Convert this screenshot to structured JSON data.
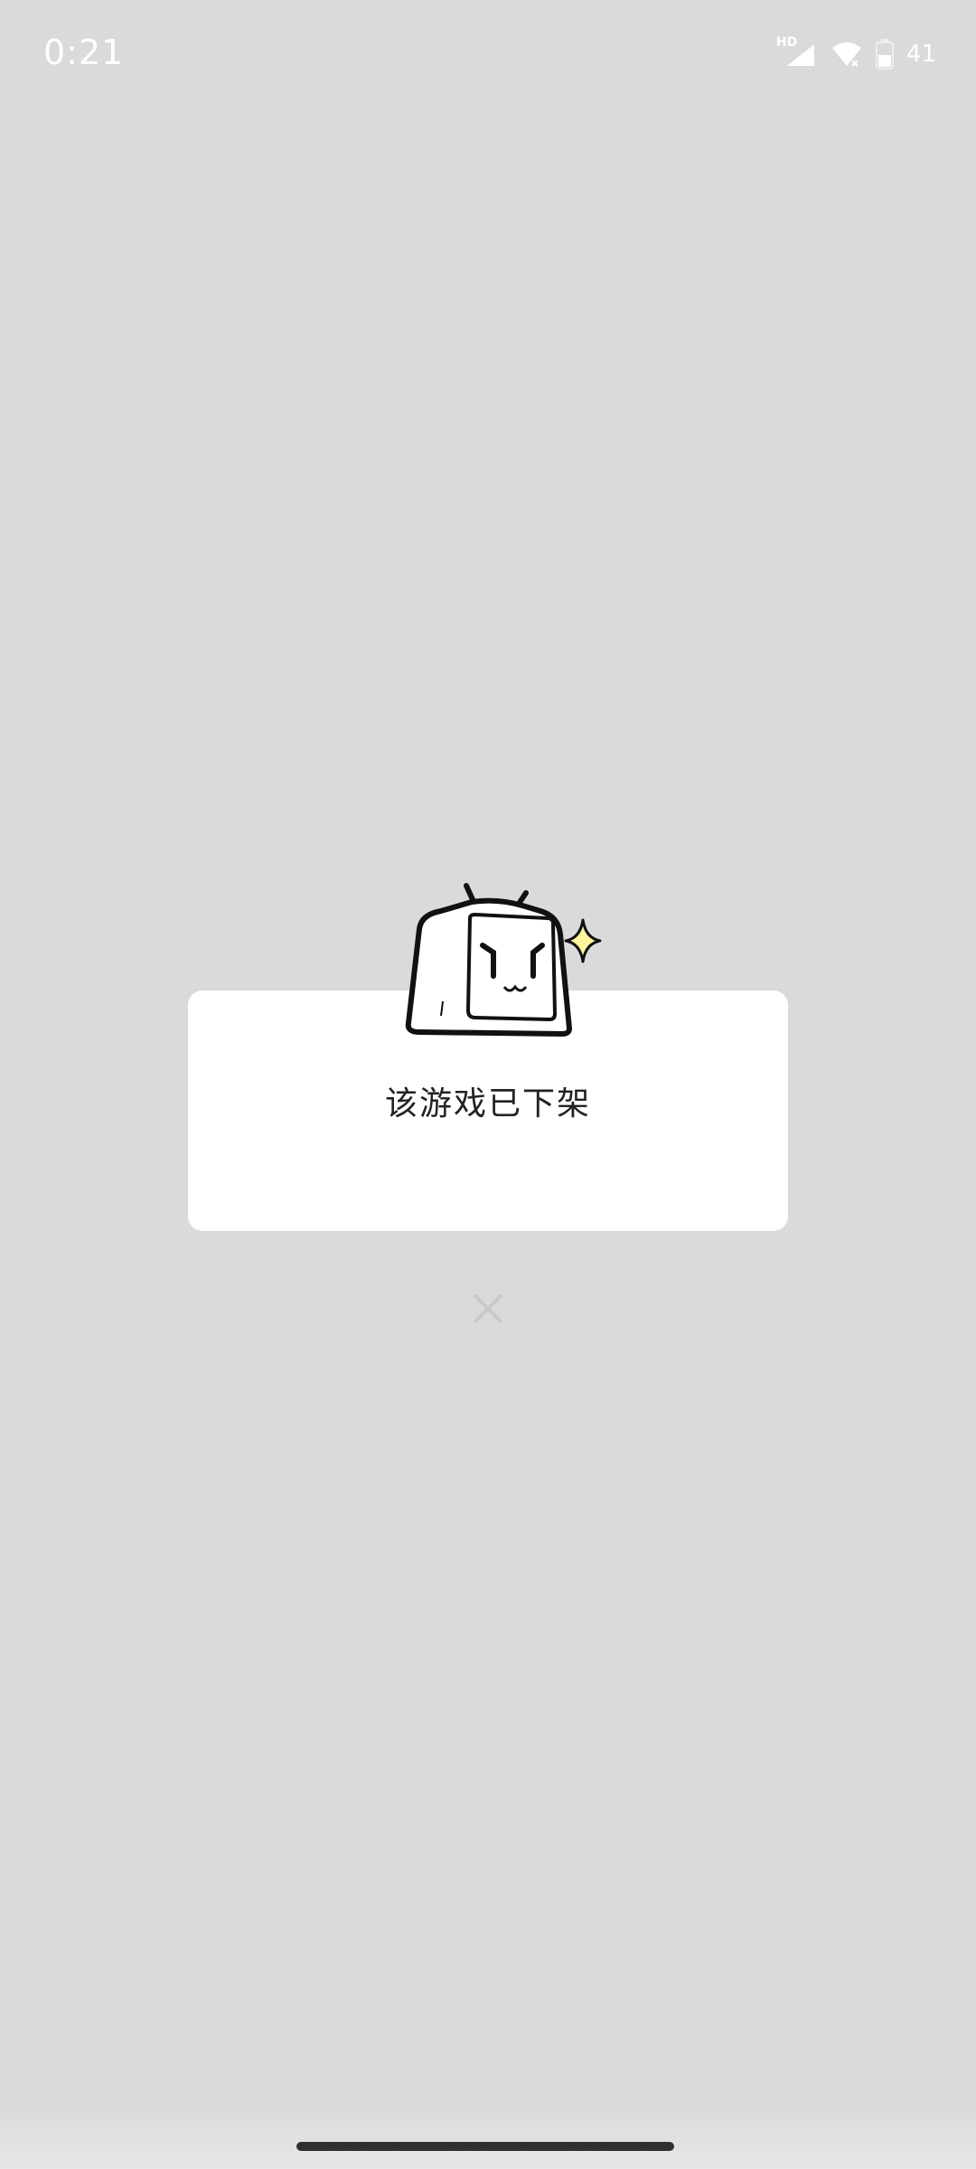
{
  "status_bar": {
    "time": "0:21",
    "hd": "HD",
    "battery": "41"
  },
  "dialog": {
    "message": "该游戏已下架"
  },
  "icons": {
    "mascot": "bilibili-tv-mascot-icon",
    "close": "close-icon",
    "signal": "signal-icon",
    "wifi": "wifi-icon",
    "battery": "battery-icon"
  },
  "colors": {
    "background": "#d9dadc",
    "card": "#ffffff",
    "text": "#222222",
    "sparkle": "#fff59a"
  }
}
